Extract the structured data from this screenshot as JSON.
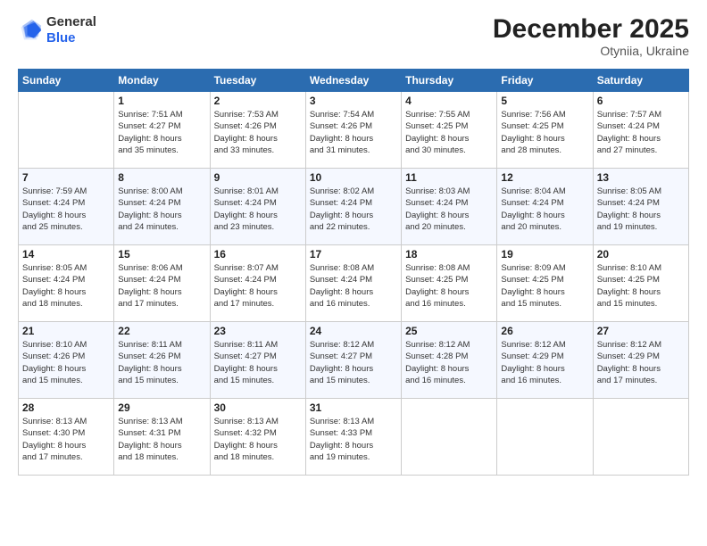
{
  "header": {
    "logo_general": "General",
    "logo_blue": "Blue",
    "month_year": "December 2025",
    "location": "Otyniia, Ukraine"
  },
  "days_of_week": [
    "Sunday",
    "Monday",
    "Tuesday",
    "Wednesday",
    "Thursday",
    "Friday",
    "Saturday"
  ],
  "weeks": [
    [
      {
        "day": "",
        "info": ""
      },
      {
        "day": "1",
        "info": "Sunrise: 7:51 AM\nSunset: 4:27 PM\nDaylight: 8 hours\nand 35 minutes."
      },
      {
        "day": "2",
        "info": "Sunrise: 7:53 AM\nSunset: 4:26 PM\nDaylight: 8 hours\nand 33 minutes."
      },
      {
        "day": "3",
        "info": "Sunrise: 7:54 AM\nSunset: 4:26 PM\nDaylight: 8 hours\nand 31 minutes."
      },
      {
        "day": "4",
        "info": "Sunrise: 7:55 AM\nSunset: 4:25 PM\nDaylight: 8 hours\nand 30 minutes."
      },
      {
        "day": "5",
        "info": "Sunrise: 7:56 AM\nSunset: 4:25 PM\nDaylight: 8 hours\nand 28 minutes."
      },
      {
        "day": "6",
        "info": "Sunrise: 7:57 AM\nSunset: 4:24 PM\nDaylight: 8 hours\nand 27 minutes."
      }
    ],
    [
      {
        "day": "7",
        "info": "Sunrise: 7:59 AM\nSunset: 4:24 PM\nDaylight: 8 hours\nand 25 minutes."
      },
      {
        "day": "8",
        "info": "Sunrise: 8:00 AM\nSunset: 4:24 PM\nDaylight: 8 hours\nand 24 minutes."
      },
      {
        "day": "9",
        "info": "Sunrise: 8:01 AM\nSunset: 4:24 PM\nDaylight: 8 hours\nand 23 minutes."
      },
      {
        "day": "10",
        "info": "Sunrise: 8:02 AM\nSunset: 4:24 PM\nDaylight: 8 hours\nand 22 minutes."
      },
      {
        "day": "11",
        "info": "Sunrise: 8:03 AM\nSunset: 4:24 PM\nDaylight: 8 hours\nand 20 minutes."
      },
      {
        "day": "12",
        "info": "Sunrise: 8:04 AM\nSunset: 4:24 PM\nDaylight: 8 hours\nand 20 minutes."
      },
      {
        "day": "13",
        "info": "Sunrise: 8:05 AM\nSunset: 4:24 PM\nDaylight: 8 hours\nand 19 minutes."
      }
    ],
    [
      {
        "day": "14",
        "info": "Sunrise: 8:05 AM\nSunset: 4:24 PM\nDaylight: 8 hours\nand 18 minutes."
      },
      {
        "day": "15",
        "info": "Sunrise: 8:06 AM\nSunset: 4:24 PM\nDaylight: 8 hours\nand 17 minutes."
      },
      {
        "day": "16",
        "info": "Sunrise: 8:07 AM\nSunset: 4:24 PM\nDaylight: 8 hours\nand 17 minutes."
      },
      {
        "day": "17",
        "info": "Sunrise: 8:08 AM\nSunset: 4:24 PM\nDaylight: 8 hours\nand 16 minutes."
      },
      {
        "day": "18",
        "info": "Sunrise: 8:08 AM\nSunset: 4:25 PM\nDaylight: 8 hours\nand 16 minutes."
      },
      {
        "day": "19",
        "info": "Sunrise: 8:09 AM\nSunset: 4:25 PM\nDaylight: 8 hours\nand 15 minutes."
      },
      {
        "day": "20",
        "info": "Sunrise: 8:10 AM\nSunset: 4:25 PM\nDaylight: 8 hours\nand 15 minutes."
      }
    ],
    [
      {
        "day": "21",
        "info": "Sunrise: 8:10 AM\nSunset: 4:26 PM\nDaylight: 8 hours\nand 15 minutes."
      },
      {
        "day": "22",
        "info": "Sunrise: 8:11 AM\nSunset: 4:26 PM\nDaylight: 8 hours\nand 15 minutes."
      },
      {
        "day": "23",
        "info": "Sunrise: 8:11 AM\nSunset: 4:27 PM\nDaylight: 8 hours\nand 15 minutes."
      },
      {
        "day": "24",
        "info": "Sunrise: 8:12 AM\nSunset: 4:27 PM\nDaylight: 8 hours\nand 15 minutes."
      },
      {
        "day": "25",
        "info": "Sunrise: 8:12 AM\nSunset: 4:28 PM\nDaylight: 8 hours\nand 16 minutes."
      },
      {
        "day": "26",
        "info": "Sunrise: 8:12 AM\nSunset: 4:29 PM\nDaylight: 8 hours\nand 16 minutes."
      },
      {
        "day": "27",
        "info": "Sunrise: 8:12 AM\nSunset: 4:29 PM\nDaylight: 8 hours\nand 17 minutes."
      }
    ],
    [
      {
        "day": "28",
        "info": "Sunrise: 8:13 AM\nSunset: 4:30 PM\nDaylight: 8 hours\nand 17 minutes."
      },
      {
        "day": "29",
        "info": "Sunrise: 8:13 AM\nSunset: 4:31 PM\nDaylight: 8 hours\nand 18 minutes."
      },
      {
        "day": "30",
        "info": "Sunrise: 8:13 AM\nSunset: 4:32 PM\nDaylight: 8 hours\nand 18 minutes."
      },
      {
        "day": "31",
        "info": "Sunrise: 8:13 AM\nSunset: 4:33 PM\nDaylight: 8 hours\nand 19 minutes."
      },
      {
        "day": "",
        "info": ""
      },
      {
        "day": "",
        "info": ""
      },
      {
        "day": "",
        "info": ""
      }
    ]
  ]
}
